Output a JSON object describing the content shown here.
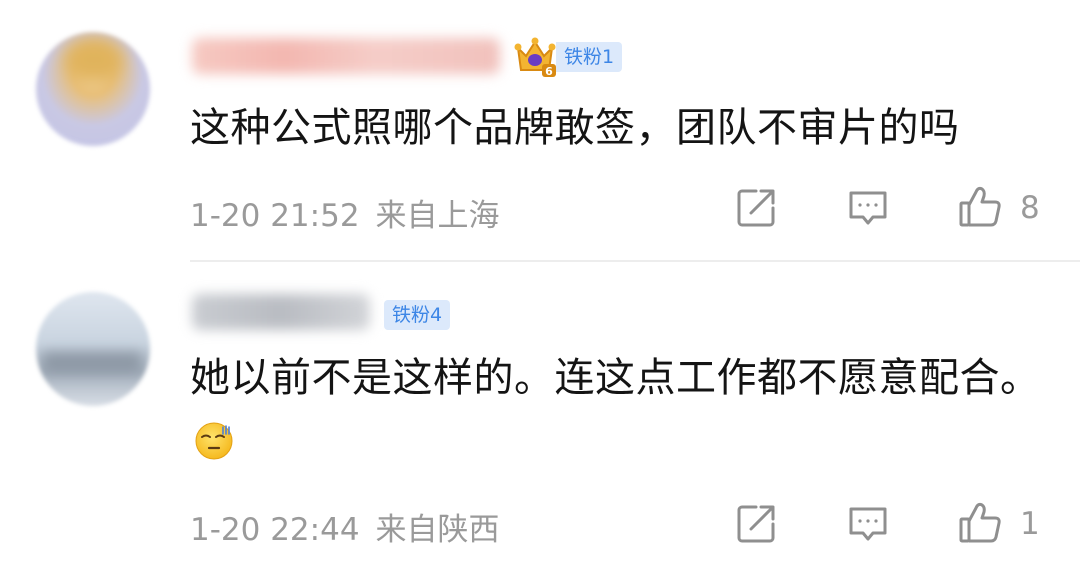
{
  "comments": [
    {
      "fan_badge": "铁粉1",
      "text": "这种公式照哪个品牌敢签，团队不审片的吗",
      "time": "1-20 21:52",
      "location": "来自上海",
      "likes": "8",
      "icons": [
        "avatar",
        "crown-level-badge",
        "share-icon",
        "reply-icon",
        "like-icon"
      ]
    },
    {
      "fan_badge": "铁粉4",
      "text": "她以前不是这样的。连这点工作都不愿意配合。",
      "time": "1-20 22:44",
      "location": "来自陕西",
      "likes": "1",
      "icons": [
        "avatar",
        "share-icon",
        "reply-icon",
        "like-icon",
        "speechless-face-emoji"
      ]
    }
  ],
  "colors": {
    "badge_bg": "#dce9fb",
    "badge_text": "#3d86e6",
    "comment_text": "#141414",
    "meta_text": "#9a9a9a"
  }
}
